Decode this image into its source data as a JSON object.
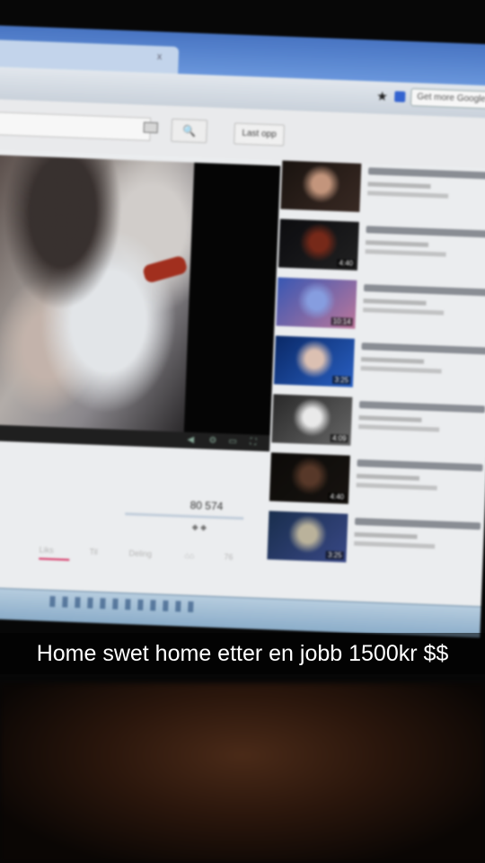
{
  "browser": {
    "tab_close_glyph": "x",
    "search_engine_placeholder": "Get more Google"
  },
  "youtube": {
    "search_icon_glyph": "🔍",
    "upload_label": "Last opp",
    "views": "80 574",
    "likes": "◆ ◆",
    "actions": [
      "Liks",
      "Til",
      "Deling",
      "⌂⌂",
      "76"
    ]
  },
  "suggestions": [
    {
      "duration": "",
      "thumb_colors": [
        "#1a1410",
        "#c99a80",
        "#3a2a24"
      ]
    },
    {
      "duration": "4:40",
      "thumb_colors": [
        "#0c0c10",
        "#7a2a1a",
        "#222"
      ]
    },
    {
      "duration": "10:14",
      "thumb_colors": [
        "#3a5ab8",
        "#8aa2e6",
        "#c27aa0"
      ]
    },
    {
      "duration": "3:25",
      "thumb_colors": [
        "#0a2a6a",
        "#e2c6b8",
        "#2a62c8"
      ]
    },
    {
      "duration": "4:09",
      "thumb_colors": [
        "#2a2a2a",
        "#f0f0f0",
        "#6a6a6a"
      ]
    },
    {
      "duration": "4:40",
      "thumb_colors": [
        "#0c0a08",
        "#5a3a2a",
        "#181410"
      ]
    },
    {
      "duration": "3:25",
      "thumb_colors": [
        "#1a3050",
        "#c0b8a0",
        "#3a4a8a"
      ]
    }
  ],
  "caption": "Home swet home etter en jobb 1500kr $$"
}
